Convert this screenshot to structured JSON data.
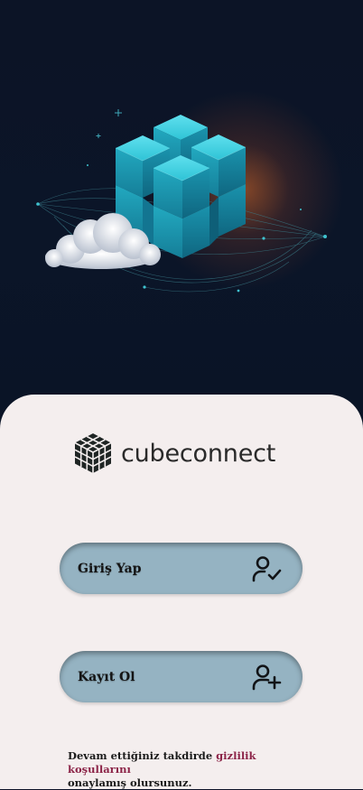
{
  "brand": {
    "name": "cubeconnect"
  },
  "icons": {
    "logo": "cube-grid-icon",
    "login": "user-check-icon",
    "register": "user-plus-icon"
  },
  "colors": {
    "sheet": "#f4eeee",
    "button": "#95b3c2",
    "link": "#8c2448",
    "hero_bg": "#0b1226",
    "cube": "#22b7cc"
  },
  "buttons": {
    "login": {
      "label": "Giriş Yap"
    },
    "register": {
      "label": "Kayıt Ol"
    }
  },
  "legal": {
    "prefix": "Devam ettiğiniz takdirde ",
    "link_text": "gizlilik koşullarını",
    "suffix": "onaylamış olursunuz."
  }
}
